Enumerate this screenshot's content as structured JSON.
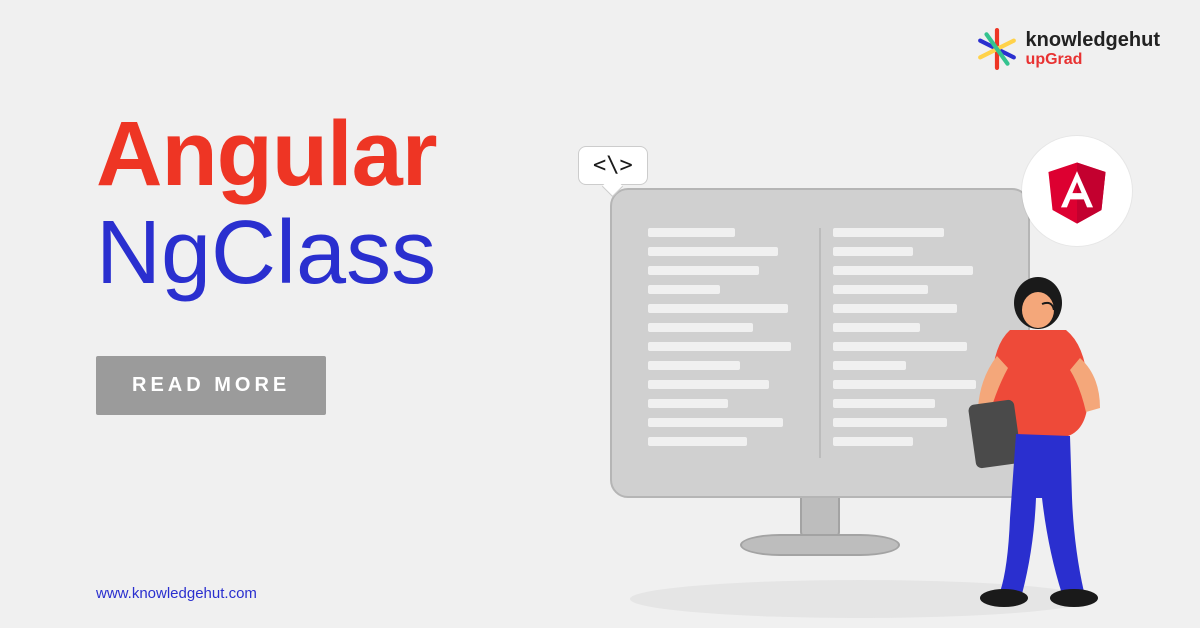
{
  "logo": {
    "name": "knowledgehut",
    "sub": "upGrad"
  },
  "headline": {
    "primary": "Angular",
    "secondary": "NgClass"
  },
  "cta": {
    "label": "READ MORE"
  },
  "footer": {
    "url": "www.knowledgehut.com"
  },
  "bubble": {
    "text": "<\\>"
  },
  "colors": {
    "accent_red": "#ee3524",
    "accent_blue": "#2a2fcf",
    "angular_red": "#dd0031",
    "cta_bg": "#9b9b9b"
  }
}
